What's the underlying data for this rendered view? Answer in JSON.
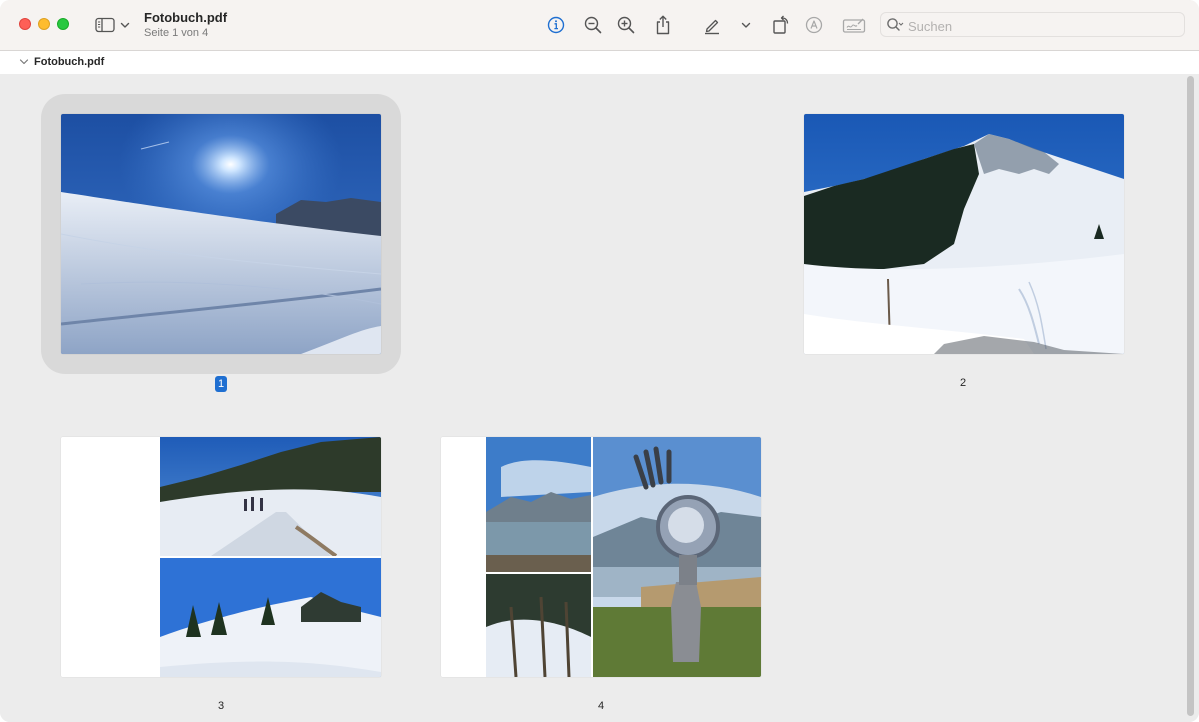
{
  "window": {
    "title": "Fotobuch.pdf",
    "subtitle": "Seite 1 von 4"
  },
  "toolbar": {
    "icons": [
      "sidebar-toggle-icon",
      "chevron-down-icon",
      "info-icon",
      "zoom-out-icon",
      "zoom-in-icon",
      "share-icon",
      "highlight-pen-icon",
      "chevron-down-icon",
      "rotate-icon",
      "markup-icon",
      "signature-icon"
    ],
    "info_color": "#1f6fd1"
  },
  "search": {
    "placeholder": "Suchen"
  },
  "pathbar": {
    "label": "Fotobuch.pdf"
  },
  "pages": [
    {
      "number": "1",
      "selected": true
    },
    {
      "number": "2",
      "selected": false
    },
    {
      "number": "3",
      "selected": false
    },
    {
      "number": "4",
      "selected": false
    }
  ],
  "colors": {
    "selection": "#1f6fd1",
    "background": "#ececec"
  }
}
